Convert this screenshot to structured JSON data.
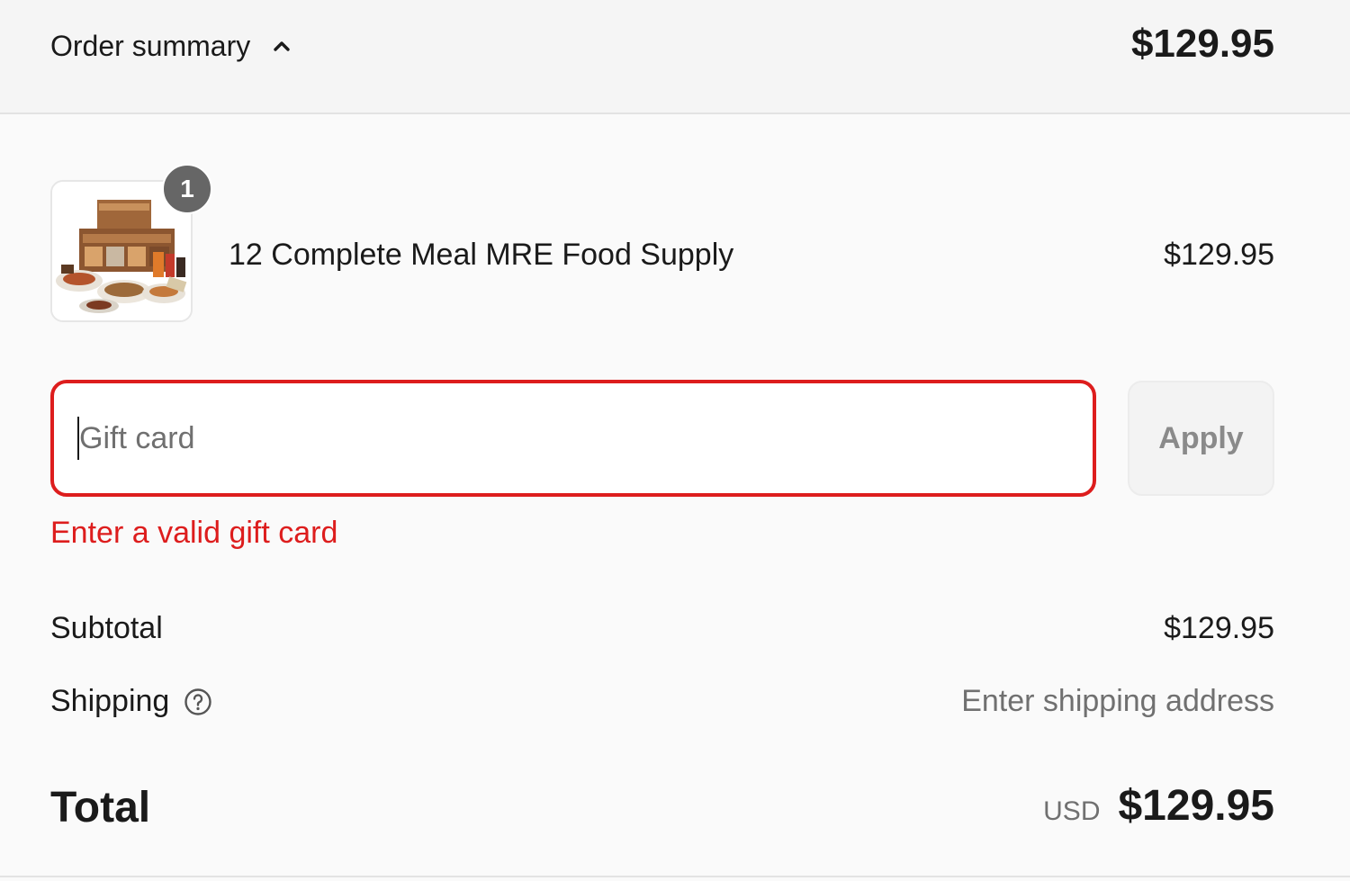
{
  "header": {
    "label": "Order summary",
    "total": "$129.95",
    "toggle_icon": "chevron-up-icon"
  },
  "line_item": {
    "name": "12 Complete Meal MRE Food Supply",
    "price": "$129.95",
    "quantity": "1",
    "image_icon": "product-image"
  },
  "gift_card": {
    "placeholder": "Gift card",
    "value": "",
    "apply_label": "Apply",
    "error": "Enter a valid gift card",
    "error_color": "#dd1d1d"
  },
  "summary": {
    "subtotal_label": "Subtotal",
    "subtotal_value": "$129.95",
    "shipping_label": "Shipping",
    "shipping_value": "Enter shipping address",
    "shipping_help_icon": "help-circle-icon",
    "total_label": "Total",
    "currency": "USD",
    "total_value": "$129.95"
  }
}
